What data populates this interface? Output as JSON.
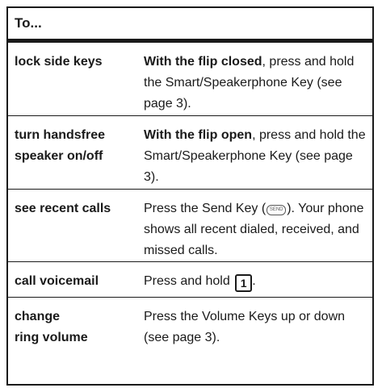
{
  "header": {
    "title": "To..."
  },
  "rows": [
    {
      "action": "lock side keys",
      "desc_bold": "With the flip closed",
      "desc_rest": ", press and hold the Smart/Speakerphone Key (see page 3)."
    },
    {
      "action": "turn handsfree speaker on/off",
      "desc_bold": "With the flip open",
      "desc_rest": ", press and hold the Smart/Speakerphone Key (see page 3)."
    },
    {
      "action": "see recent calls",
      "desc_pre": "Press the Send Key (",
      "key_icon": "SEND",
      "desc_post": "). Your phone shows all recent dialed, received, and missed calls."
    },
    {
      "action": "call voicemail",
      "desc_pre": "Press and hold ",
      "key_label": "1",
      "desc_post": "."
    },
    {
      "action_line1": "change",
      "action_line2": "ring volume",
      "desc": "Press the Volume Keys up or down (see page 3)."
    }
  ]
}
